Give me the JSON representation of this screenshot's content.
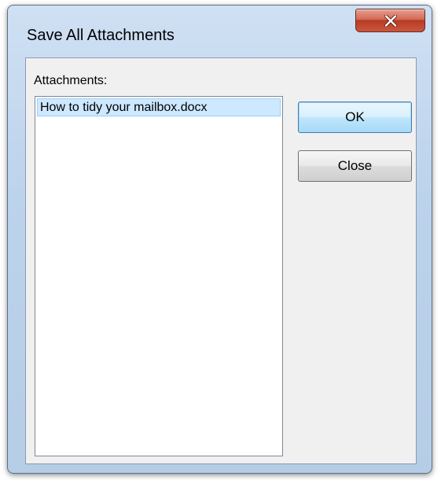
{
  "window": {
    "title": "Save All Attachments",
    "close_icon": "close-x-icon"
  },
  "attachments": {
    "label": "Attachments:",
    "items": [
      {
        "name": "How to tidy your mailbox.docx",
        "selected": true
      }
    ]
  },
  "buttons": {
    "ok_label": "OK",
    "close_label": "Close"
  },
  "colors": {
    "frame": "#bcd3ec",
    "client": "#f0f0f0",
    "selection": "#cde8ff",
    "close_button": "#c9573f",
    "default_button_border": "#3c7fb1"
  }
}
